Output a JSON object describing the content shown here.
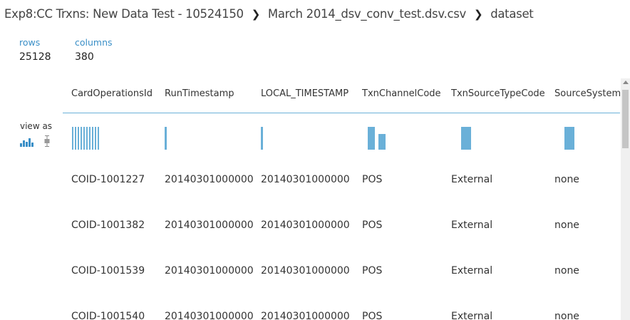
{
  "breadcrumb": {
    "experiment": "Exp8:CC Trxns: New Data Test - 10524150",
    "file": "March 2014_dsv_conv_test.dsv.csv",
    "current": "dataset",
    "separator": "❯"
  },
  "stats": {
    "rows_label": "rows",
    "rows_value": "25128",
    "columns_label": "columns",
    "columns_value": "380"
  },
  "view_as": {
    "label": "view as",
    "icons": [
      "histogram-icon",
      "boxplot-icon"
    ]
  },
  "colors": {
    "accent": "#3a8fc7",
    "bar": "#6ab0d8"
  },
  "table": {
    "columns": [
      "CardOperationsId",
      "RunTimestamp",
      "LOCAL_TIMESTAMP",
      "TxnChannelCode",
      "TxnSourceTypeCode",
      "SourceSystemC"
    ],
    "rows": [
      [
        "COID-1001227",
        "20140301000000",
        "20140301000000",
        "POS",
        "External",
        "none"
      ],
      [
        "COID-1001382",
        "20140301000000",
        "20140301000000",
        "POS",
        "External",
        "none"
      ],
      [
        "COID-1001539",
        "20140301000000",
        "20140301000000",
        "POS",
        "External",
        "none"
      ],
      [
        "COID-1001540",
        "20140301000000",
        "20140301000000",
        "POS",
        "External",
        "none"
      ]
    ]
  }
}
